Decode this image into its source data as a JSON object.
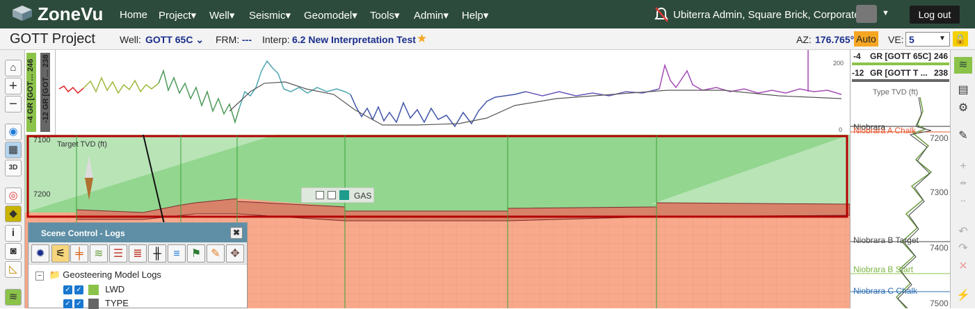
{
  "app": {
    "brand": "ZoneVu",
    "menu": [
      "Home",
      "Project▾",
      "Well▾",
      "Seismic▾",
      "Geomodel▾",
      "Tools▾",
      "Admin▾",
      "Help▾"
    ],
    "user": "Ubiterra Admin, Square Brick, Corporate",
    "logout": "Log out"
  },
  "project": {
    "title": "GOTT Project",
    "well_label": "Well:",
    "well_value": "GOTT 65C ⌄",
    "frm_label": "FRM:",
    "frm_value": "---",
    "interp_label": "Interp:",
    "interp_value": "6.2 New Interpretation Test",
    "az_label": "AZ:",
    "az_value": "176.765°",
    "auto_label": "Auto",
    "ve_label": "VE:",
    "ve_value": "5"
  },
  "tracks": {
    "left1": "-4  GR [GOT…  246",
    "left2": "-12  GR [GOT…  238",
    "scale_top": "200",
    "scale_bottom": "0"
  },
  "main": {
    "target_label": "Target TVD (ft)",
    "depths": [
      "7100",
      "7200"
    ],
    "gas_label": "GAS"
  },
  "right": {
    "hdr1_min": "-4",
    "hdr1_name": "GR [GOTT 65C]",
    "hdr1_max": "246",
    "hdr2_min": "-12",
    "hdr2_name": "GR [GOTT T ...",
    "hdr2_max": "238",
    "type_label": "Type TVD (ft)",
    "depths": [
      "7200",
      "7300",
      "7400",
      "7500"
    ],
    "formations": [
      "Niobrara",
      "Niobrara A Chalk",
      "Niobrara B Target",
      "Niobrara B Start",
      "Niobrara C Chalk"
    ]
  },
  "scene": {
    "title": "Scene Control - Logs",
    "close": "✖",
    "root": "Geosteering Model Logs",
    "items": [
      "LWD",
      "TYPE"
    ]
  },
  "colors": {
    "nav": "#2d4b3c",
    "green_fill": "#93d68f",
    "salmon_fill": "#f8a98b",
    "frame": "#b40000",
    "lwd": "#8bc34a",
    "type": "#666666"
  }
}
